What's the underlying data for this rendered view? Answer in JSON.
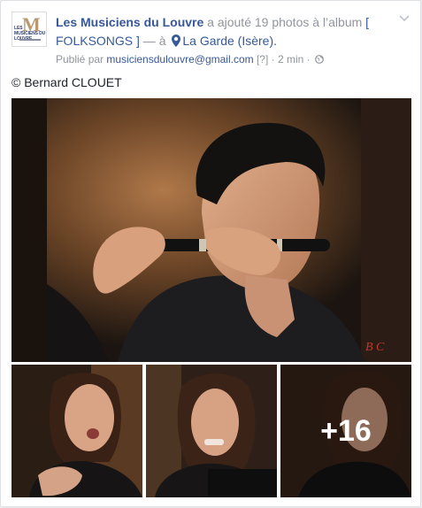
{
  "post": {
    "author": "Les Musiciens du Louvre",
    "action": " a ajouté 19 photos à l’album ",
    "album": "[ FOLKSONGS ]",
    "dash": " — à ",
    "location": "La Garde (Isère).",
    "published_prefix": "Publié par ",
    "email": "musiciensdulouvre@gmail.com",
    "help": " [?] · ",
    "time": "2 min",
    "dot": " · ",
    "caption": "© Bernard CLOUET",
    "more_count": "+16"
  },
  "avatar": {
    "logo_letter": "M",
    "logo_text": "LES MUSICIENS DU LOUVRE"
  },
  "icons": [
    "chevron-down-icon",
    "location-pin-icon",
    "globe-icon"
  ],
  "colors": {
    "link": "#365899",
    "meta": "#90949c",
    "text": "#1d2129"
  }
}
